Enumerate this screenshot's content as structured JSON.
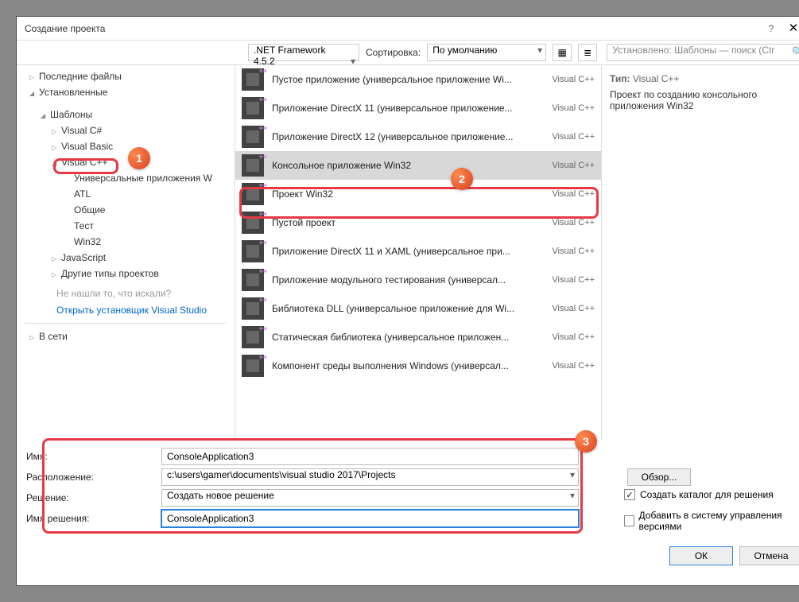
{
  "title": "Создание проекта",
  "framework": ".NET Framework 4.5.2",
  "sort_label": "Сортировка:",
  "sort_value": "По умолчанию",
  "search_placeholder": "Установлено: Шаблоны — поиск (Ctr",
  "sidebar": {
    "recent": "Последние файлы",
    "installed": "Установленные",
    "templates": "Шаблоны",
    "csharp": "Visual C#",
    "vb": "Visual Basic",
    "cpp": "Visual C++",
    "cpp_children": [
      "Универсальные приложения W",
      "ATL",
      "Общие",
      "Тест",
      "Win32"
    ],
    "js": "JavaScript",
    "other": "Другие типы проектов",
    "not_found": "Не нашли то, что искали?",
    "open_installer": "Открыть установщик Visual Studio",
    "online": "В сети"
  },
  "templates": [
    {
      "name": "Пустое приложение (универсальное приложение Wi...",
      "lang": "Visual C++"
    },
    {
      "name": "Приложение DirectX 11 (универсальное приложение...",
      "lang": "Visual C++"
    },
    {
      "name": "Приложение DirectX 12 (универсальное приложение...",
      "lang": "Visual C++"
    },
    {
      "name": "Консольное приложение Win32",
      "lang": "Visual C++"
    },
    {
      "name": "Проект Win32",
      "lang": "Visual C++"
    },
    {
      "name": "Пустой проект",
      "lang": "Visual C++"
    },
    {
      "name": "Приложение DirectX 11 и XAML (универсальное при...",
      "lang": "Visual C++"
    },
    {
      "name": "Приложение модульного тестирования (универсал...",
      "lang": "Visual C++"
    },
    {
      "name": "Библиотека DLL (универсальное приложение для Wi...",
      "lang": "Visual C++"
    },
    {
      "name": "Статическая библиотека (универсальное приложен...",
      "lang": "Visual C++"
    },
    {
      "name": "Компонент среды выполнения Windows (универсал...",
      "lang": "Visual C++"
    }
  ],
  "info": {
    "type_label": "Тип:",
    "type_value": "Visual C++",
    "description": "Проект по созданию консольного приложения Win32"
  },
  "form": {
    "name_label": "Имя:",
    "name_value": "ConsoleApplication3",
    "location_label": "Расположение:",
    "location_value": "c:\\users\\gamer\\documents\\visual studio 2017\\Projects",
    "solution_label": "Решение:",
    "solution_value": "Создать новое решение",
    "solname_label": "Имя решения:",
    "solname_value": "ConsoleApplication3",
    "browse": "Обзор...",
    "create_dir": "Создать каталог для решения",
    "create_dir_checked": true,
    "add_source": "Добавить в систему управления версиями"
  },
  "buttons": {
    "ok": "ОК",
    "cancel": "Отмена"
  }
}
